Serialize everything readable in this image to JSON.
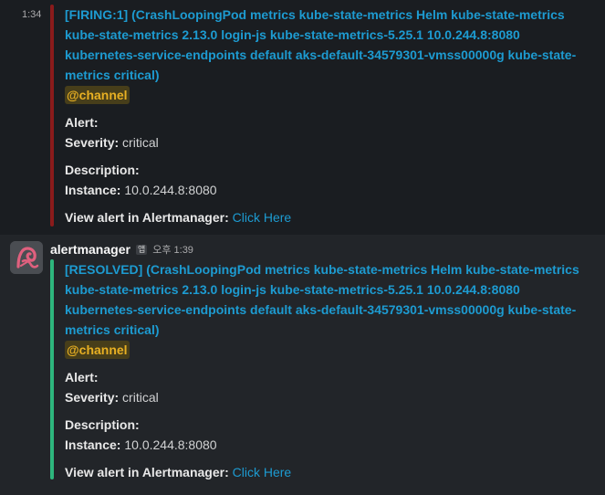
{
  "messages": [
    {
      "time": "1:34",
      "title": "[FIRING:1]  (CrashLoopingPod metrics kube-state-metrics Helm kube-state-metrics kube-state-metrics 2.13.0 login-js kube-state-metrics-5.25.1 10.0.244.8:8080 kubernetes-service-endpoints default aks-default-34579301-vmss00000g kube-state-metrics critical)",
      "mention": "@channel",
      "alert_label": "Alert:",
      "severity_label": "Severity:",
      "severity_value": "critical",
      "description_label": "Description:",
      "instance_label": "Instance:",
      "instance_value": "10.0.244.8:8080",
      "view_label": "View alert in Alertmanager:",
      "view_link": "Click Here",
      "bar_color": "#8a1b1b"
    },
    {
      "sender": "alertmanager",
      "app_badge": "앱",
      "time": "오후 1:39",
      "title": "[RESOLVED]  (CrashLoopingPod metrics kube-state-metrics Helm kube-state-metrics kube-state-metrics 2.13.0 login-js kube-state-metrics-5.25.1 10.0.244.8:8080 kubernetes-service-endpoints default aks-default-34579301-vmss00000g kube-state-metrics critical)",
      "mention": "@channel",
      "alert_label": "Alert:",
      "severity_label": "Severity:",
      "severity_value": "critical",
      "description_label": "Description:",
      "instance_label": "Instance:",
      "instance_value": "10.0.244.8:8080",
      "view_label": "View alert in Alertmanager:",
      "view_link": "Click Here",
      "bar_color": "#2eb67d",
      "avatar_icon": "alertmanager-logo-icon"
    }
  ],
  "colors": {
    "background": "#1a1d21",
    "hover_background": "#222529",
    "link": "#1d9bd1",
    "mention_text": "#e8b023",
    "mention_bg": "#473e1a"
  }
}
